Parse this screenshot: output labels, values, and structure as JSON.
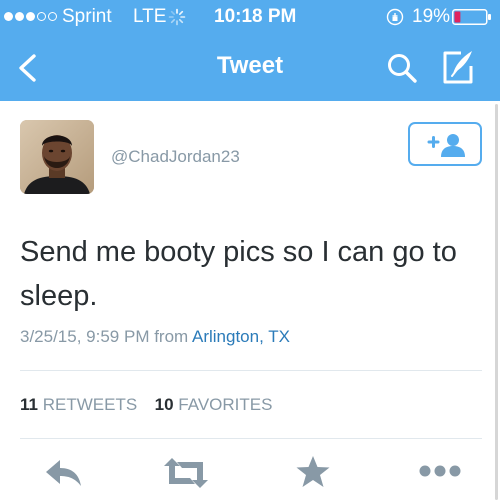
{
  "status_bar": {
    "carrier": "Sprint",
    "network": "LTE",
    "time": "10:18 PM",
    "battery": "19%",
    "signal_bars_filled": 3,
    "signal_bars_total": 5,
    "battery_level": 0.19
  },
  "nav": {
    "title": "Tweet",
    "icons": [
      "back-arrow",
      "search",
      "compose"
    ]
  },
  "tweet": {
    "username": "@ChadJordan23",
    "text": "Send me booty pics so I can go to sleep.",
    "date": "3/25/15, 9:59 PM from ",
    "location": "Arlington, TX",
    "retweets_count": "11",
    "retweets_label": "RETWEETS",
    "favorites_count": "10",
    "favorites_label": "FAVORITES"
  },
  "actions": [
    "reply",
    "retweet",
    "favorite",
    "more"
  ],
  "colors": {
    "brand": "#55acee",
    "link": "#2b7bb9",
    "text": "#292f33",
    "muted": "#8899a6",
    "icon": "#8899a6",
    "battery_low": "#e0245e"
  }
}
